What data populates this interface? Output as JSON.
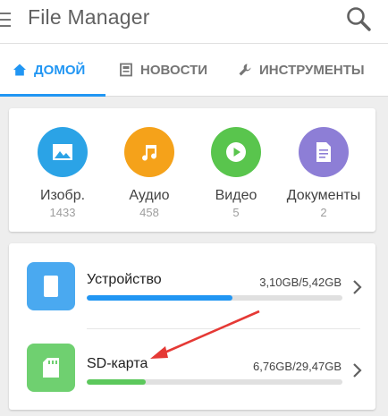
{
  "app": {
    "title": "File Manager"
  },
  "tabs": [
    {
      "label": "ДОМОЙ",
      "icon": "home-icon",
      "active": true
    },
    {
      "label": "НОВОСТИ",
      "icon": "news-icon",
      "active": false
    },
    {
      "label": "ИНСТРУМЕНТЫ",
      "icon": "wrench-icon",
      "active": false
    }
  ],
  "categories": [
    {
      "label": "Изобр.",
      "count": "1433",
      "icon": "image-icon",
      "color": "#2ba3e6"
    },
    {
      "label": "Аудио",
      "count": "458",
      "icon": "music-note-icon",
      "color": "#f5a21a"
    },
    {
      "label": "Видео",
      "count": "5",
      "icon": "play-icon",
      "color": "#59c54d"
    },
    {
      "label": "Документы",
      "count": "2",
      "icon": "document-icon",
      "color": "#8d7ed6"
    }
  ],
  "storage": [
    {
      "name": "Устройство",
      "size": "3,10GB/5,42GB",
      "used_fraction": 0.57,
      "icon": "phone-icon",
      "color": "#4aa9f0",
      "bar_color": "#2196f3"
    },
    {
      "name": "SD-карта",
      "size": "6,76GB/29,47GB",
      "used_fraction": 0.23,
      "icon": "sd-card-icon",
      "color": "#6fd070",
      "bar_color": "#5cc85c"
    }
  ],
  "colors": {
    "accent": "#2196f3",
    "annotation_arrow": "#e53935"
  }
}
